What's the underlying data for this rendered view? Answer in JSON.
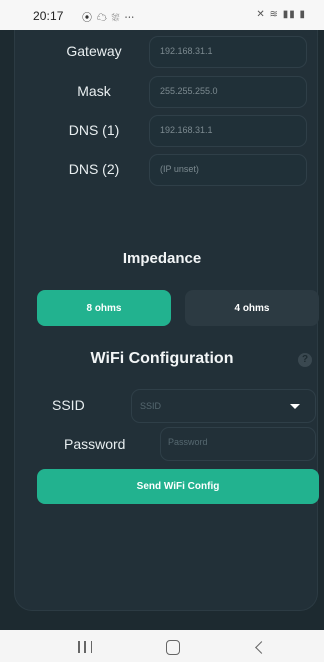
{
  "status_bar": {
    "time": "20:17",
    "left_icons": "⦿ ☁ ⛆ ⋯",
    "right_icons": "✕ ≋ ▮▮ ▮"
  },
  "network": {
    "rows": [
      {
        "label": "Gateway",
        "value": "192.168.31.1"
      },
      {
        "label": "Mask",
        "value": "255.255.255.0"
      },
      {
        "label": "DNS (1)",
        "value": "192.168.31.1"
      },
      {
        "label": "DNS (2)",
        "value": "(IP unset)"
      }
    ]
  },
  "impedance": {
    "title": "Impedance",
    "options": [
      {
        "label": "8 ohms",
        "selected": true
      },
      {
        "label": "4 ohms",
        "selected": false
      }
    ]
  },
  "wifi": {
    "title": "WiFi Configuration",
    "help_icon": "?",
    "ssid_label": "SSID",
    "ssid_value": "SSID",
    "password_label": "Password",
    "password_placeholder": "Password",
    "send_label": "Send WiFi Config"
  },
  "colors": {
    "accent": "#22b28f",
    "background": "#1d2a30",
    "panel": "#223038"
  }
}
